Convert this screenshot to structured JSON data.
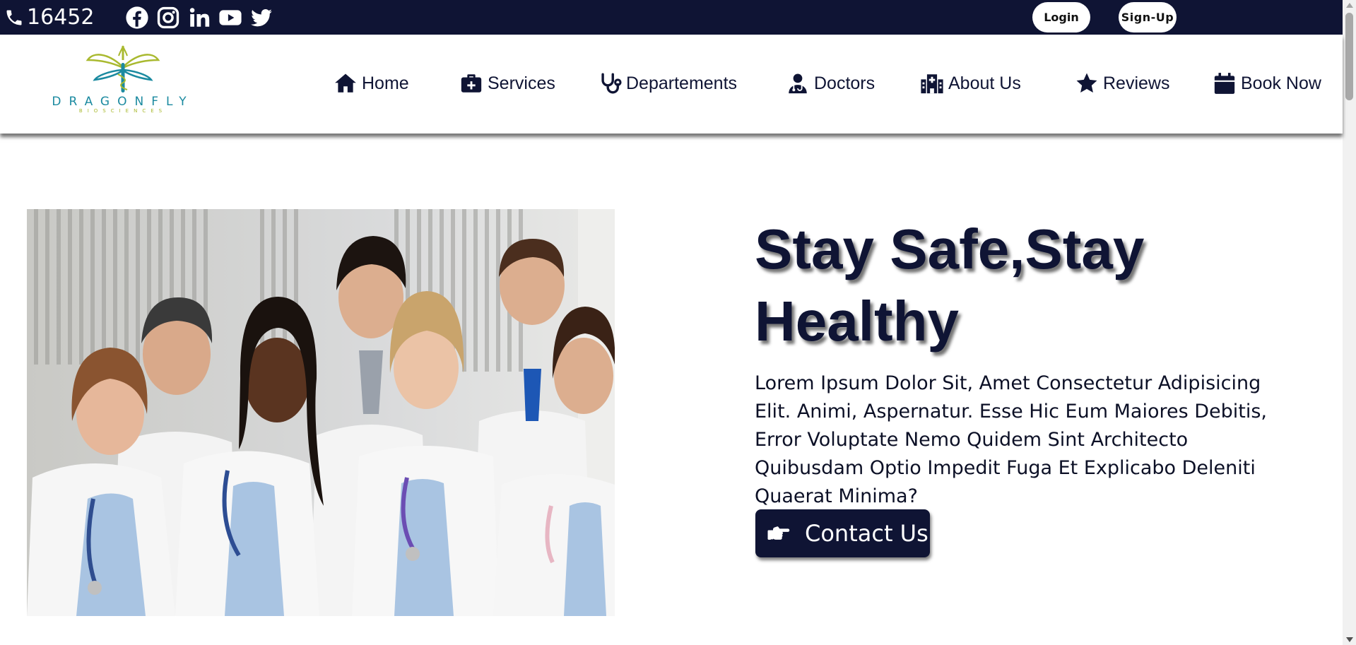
{
  "topbar": {
    "phone": "16452",
    "phone_icon": "phone-icon",
    "socials": [
      "facebook-icon",
      "instagram-icon",
      "linkedin-icon",
      "youtube-icon",
      "twitter-icon"
    ],
    "login_label": "Login",
    "signup_label": "Sign-Up"
  },
  "brand": {
    "name": "DRAGONFLY",
    "tagline": "BIOSCIENCES",
    "colors": {
      "teal": "#1b8aa0",
      "lime": "#a9b92f"
    }
  },
  "nav": {
    "items": [
      {
        "label": "Home",
        "icon": "house-icon"
      },
      {
        "label": "Services",
        "icon": "medkit-icon"
      },
      {
        "label": "Departements",
        "icon": "stethoscope-icon"
      },
      {
        "label": "Doctors",
        "icon": "user-doctor-icon"
      },
      {
        "label": "About Us",
        "icon": "hospital-icon"
      },
      {
        "label": "Reviews",
        "icon": "star-icon"
      },
      {
        "label": "Book Now",
        "icon": "calendar-icon"
      }
    ]
  },
  "hero": {
    "title": "Stay Safe,Stay Healthy",
    "text": "Lorem Ipsum Dolor Sit, Amet Consectetur Adipisicing Elit. Animi, Aspernatur. Esse Hic Eum Maiores Debitis, Error Voluptate Nemo Quidem Sint Architecto Quibusdam Optio Impedit Fuga Et Explicabo Deleniti Quaerat Minima?",
    "cta_label": "Contact Us",
    "cta_icon": "hand-point-right-icon",
    "image": "group of doctors photo"
  },
  "colors": {
    "navy": "#0f1434",
    "white": "#ffffff"
  }
}
